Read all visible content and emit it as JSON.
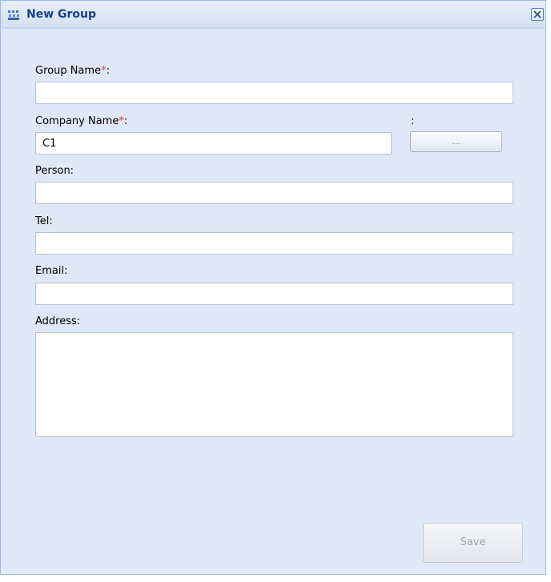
{
  "window": {
    "title": "New Group",
    "icon": "group-icon",
    "close_icon": "close-icon"
  },
  "form": {
    "group_name": {
      "label": "Group Name",
      "required_mark": "*",
      "suffix": ":",
      "value": ""
    },
    "company_name": {
      "label": "Company Name",
      "required_mark": "*",
      "suffix": ":",
      "value": "C1"
    },
    "lookup": {
      "colon": ":",
      "button_label": "..."
    },
    "person": {
      "label": "Person:",
      "value": ""
    },
    "tel": {
      "label": "Tel:",
      "value": ""
    },
    "email": {
      "label": "Email:",
      "value": ""
    },
    "address": {
      "label": "Address:",
      "value": ""
    }
  },
  "actions": {
    "save_label": "Save"
  }
}
